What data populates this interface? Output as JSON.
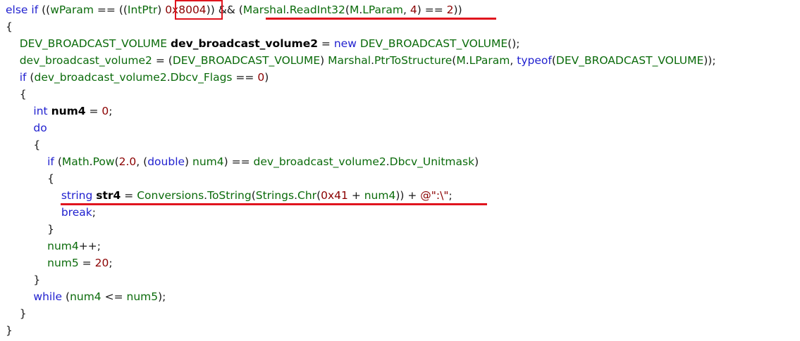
{
  "code_lines": [
    {
      "tokens": [
        {
          "t": "else if ",
          "c": "kw"
        },
        {
          "t": "((",
          "c": "op"
        },
        {
          "t": "wParam",
          "c": "id"
        },
        {
          "t": " == ((",
          "c": "op"
        },
        {
          "t": "IntPtr",
          "c": "id"
        },
        {
          "t": ") ",
          "c": "op"
        },
        {
          "t": "0x8004",
          "c": "num"
        },
        {
          "t": ")) && (",
          "c": "op"
        },
        {
          "t": "Marshal",
          "c": "id"
        },
        {
          "t": ".",
          "c": "op"
        },
        {
          "t": "ReadInt32",
          "c": "id"
        },
        {
          "t": "(",
          "c": "op"
        },
        {
          "t": "M",
          "c": "id"
        },
        {
          "t": ".",
          "c": "op"
        },
        {
          "t": "LParam",
          "c": "id"
        },
        {
          "t": ", ",
          "c": "op"
        },
        {
          "t": "4",
          "c": "num"
        },
        {
          "t": ") == ",
          "c": "op"
        },
        {
          "t": "2",
          "c": "num"
        },
        {
          "t": "))",
          "c": "op"
        }
      ]
    },
    {
      "tokens": [
        {
          "t": "{",
          "c": "op"
        }
      ]
    },
    {
      "tokens": [
        {
          "t": "    "
        },
        {
          "t": "DEV_BROADCAST_VOLUME",
          "c": "id"
        },
        {
          "t": " ",
          "c": "op"
        },
        {
          "t": "dev_broadcast_volume2",
          "c": "b"
        },
        {
          "t": " = ",
          "c": "op"
        },
        {
          "t": "new ",
          "c": "kw"
        },
        {
          "t": "DEV_BROADCAST_VOLUME",
          "c": "id"
        },
        {
          "t": "();",
          "c": "op"
        }
      ]
    },
    {
      "tokens": [
        {
          "t": "    "
        },
        {
          "t": "dev_broadcast_volume2",
          "c": "id"
        },
        {
          "t": " = (",
          "c": "op"
        },
        {
          "t": "DEV_BROADCAST_VOLUME",
          "c": "id"
        },
        {
          "t": ") ",
          "c": "op"
        },
        {
          "t": "Marshal",
          "c": "id"
        },
        {
          "t": ".",
          "c": "op"
        },
        {
          "t": "PtrToStructure",
          "c": "id"
        },
        {
          "t": "(",
          "c": "op"
        },
        {
          "t": "M",
          "c": "id"
        },
        {
          "t": ".",
          "c": "op"
        },
        {
          "t": "LParam",
          "c": "id"
        },
        {
          "t": ", ",
          "c": "op"
        },
        {
          "t": "typeof",
          "c": "kw"
        },
        {
          "t": "(",
          "c": "op"
        },
        {
          "t": "DEV_BROADCAST_VOLUME",
          "c": "id"
        },
        {
          "t": "));",
          "c": "op"
        }
      ]
    },
    {
      "tokens": [
        {
          "t": "    "
        },
        {
          "t": "if ",
          "c": "kw"
        },
        {
          "t": "(",
          "c": "op"
        },
        {
          "t": "dev_broadcast_volume2",
          "c": "id"
        },
        {
          "t": ".",
          "c": "op"
        },
        {
          "t": "Dbcv_Flags",
          "c": "id"
        },
        {
          "t": " == ",
          "c": "op"
        },
        {
          "t": "0",
          "c": "num"
        },
        {
          "t": ")",
          "c": "op"
        }
      ]
    },
    {
      "tokens": [
        {
          "t": "    "
        },
        {
          "t": "{",
          "c": "op"
        }
      ]
    },
    {
      "tokens": [
        {
          "t": "        "
        },
        {
          "t": "int ",
          "c": "kw"
        },
        {
          "t": "num4",
          "c": "b"
        },
        {
          "t": " = ",
          "c": "op"
        },
        {
          "t": "0",
          "c": "num"
        },
        {
          "t": ";",
          "c": "op"
        }
      ]
    },
    {
      "tokens": [
        {
          "t": "        "
        },
        {
          "t": "do",
          "c": "kw"
        }
      ]
    },
    {
      "tokens": [
        {
          "t": "        "
        },
        {
          "t": "{",
          "c": "op"
        }
      ]
    },
    {
      "tokens": [
        {
          "t": "            "
        },
        {
          "t": "if ",
          "c": "kw"
        },
        {
          "t": "(",
          "c": "op"
        },
        {
          "t": "Math",
          "c": "id"
        },
        {
          "t": ".",
          "c": "op"
        },
        {
          "t": "Pow",
          "c": "id"
        },
        {
          "t": "(",
          "c": "op"
        },
        {
          "t": "2.0",
          "c": "num"
        },
        {
          "t": ", (",
          "c": "op"
        },
        {
          "t": "double",
          "c": "kw"
        },
        {
          "t": ") ",
          "c": "op"
        },
        {
          "t": "num4",
          "c": "id"
        },
        {
          "t": ") == ",
          "c": "op"
        },
        {
          "t": "dev_broadcast_volume2",
          "c": "id"
        },
        {
          "t": ".",
          "c": "op"
        },
        {
          "t": "Dbcv_Unitmask",
          "c": "id"
        },
        {
          "t": ")",
          "c": "op"
        }
      ]
    },
    {
      "tokens": [
        {
          "t": "            "
        },
        {
          "t": "{",
          "c": "op"
        }
      ]
    },
    {
      "tokens": [
        {
          "t": "                "
        },
        {
          "t": "string ",
          "c": "kw"
        },
        {
          "t": "str4",
          "c": "b"
        },
        {
          "t": " = ",
          "c": "op"
        },
        {
          "t": "Conversions",
          "c": "id"
        },
        {
          "t": ".",
          "c": "op"
        },
        {
          "t": "ToString",
          "c": "id"
        },
        {
          "t": "(",
          "c": "op"
        },
        {
          "t": "Strings",
          "c": "id"
        },
        {
          "t": ".",
          "c": "op"
        },
        {
          "t": "Chr",
          "c": "id"
        },
        {
          "t": "(",
          "c": "op"
        },
        {
          "t": "0x41",
          "c": "num"
        },
        {
          "t": " + ",
          "c": "op"
        },
        {
          "t": "num4",
          "c": "id"
        },
        {
          "t": ")) + ",
          "c": "op"
        },
        {
          "t": "@\":\\\"",
          "c": "str"
        },
        {
          "t": ";",
          "c": "op"
        }
      ]
    },
    {
      "tokens": [
        {
          "t": "                "
        },
        {
          "t": "break",
          "c": "kw"
        },
        {
          "t": ";",
          "c": "op"
        }
      ]
    },
    {
      "tokens": [
        {
          "t": "            "
        },
        {
          "t": "}",
          "c": "op"
        }
      ]
    },
    {
      "tokens": [
        {
          "t": "            "
        },
        {
          "t": "num4",
          "c": "id"
        },
        {
          "t": "++;",
          "c": "op"
        }
      ]
    },
    {
      "tokens": [
        {
          "t": "            "
        },
        {
          "t": "num5",
          "c": "id"
        },
        {
          "t": " = ",
          "c": "op"
        },
        {
          "t": "20",
          "c": "num"
        },
        {
          "t": ";",
          "c": "op"
        }
      ]
    },
    {
      "tokens": [
        {
          "t": "        "
        },
        {
          "t": "}",
          "c": "op"
        }
      ]
    },
    {
      "tokens": [
        {
          "t": "        "
        },
        {
          "t": "while ",
          "c": "kw"
        },
        {
          "t": "(",
          "c": "op"
        },
        {
          "t": "num4",
          "c": "id"
        },
        {
          "t": " <= ",
          "c": "op"
        },
        {
          "t": "num5",
          "c": "id"
        },
        {
          "t": ");",
          "c": "op"
        }
      ]
    },
    {
      "tokens": [
        {
          "t": "    "
        },
        {
          "t": "}",
          "c": "op"
        }
      ]
    },
    {
      "tokens": [
        {
          "t": "}",
          "c": "op"
        }
      ]
    }
  ],
  "highlight_color": "#e0141e",
  "annotations": [
    {
      "kind": "box",
      "target": "0x8004"
    },
    {
      "kind": "underline",
      "target": "Marshal.ReadInt32(M.LParam, 4) == 2"
    },
    {
      "kind": "underline",
      "target": "string str4 = Conversions.ToString(Strings.Chr(0x41 + num4)) + @\":\\\";"
    }
  ]
}
